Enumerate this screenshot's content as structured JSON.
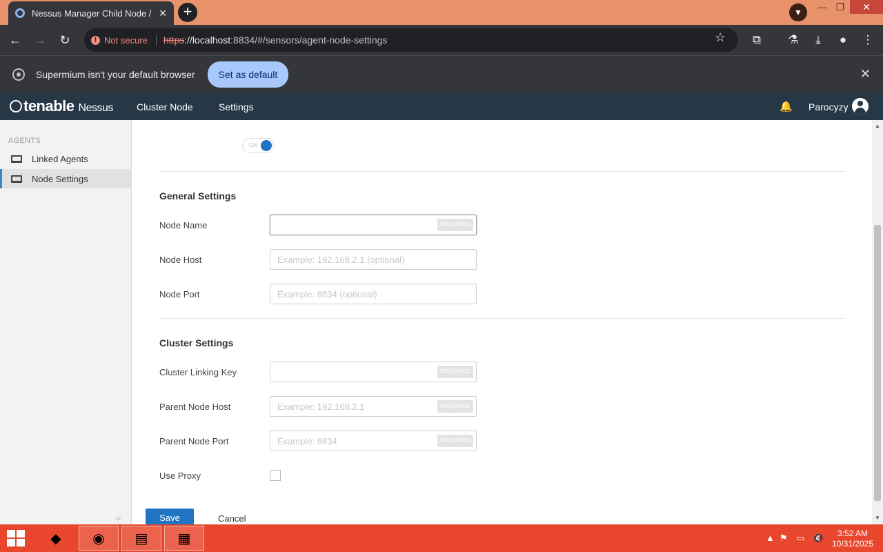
{
  "browser": {
    "tab_title": "Nessus Manager Child Node / P",
    "tab_close": "✕",
    "new_tab": "+",
    "security_label": "Not secure",
    "url_scheme": "https",
    "url_host": "://localhost",
    "url_rest": ":8834/#/sensors/agent-node-settings",
    "infobar_message": "Supermium isn't your default browser",
    "set_default_label": "Set as default"
  },
  "app": {
    "brand": "tenable",
    "product": "Nessus",
    "nav": [
      "Cluster Node",
      "Settings"
    ],
    "username": "Parocyzy"
  },
  "sidebar": {
    "heading": "AGENTS",
    "items": [
      {
        "label": "Linked Agents",
        "active": false
      },
      {
        "label": "Node Settings",
        "active": true
      }
    ],
    "collapse": "«"
  },
  "form": {
    "toggle_label": "ON",
    "general_heading": "General Settings",
    "cluster_heading": "Cluster Settings",
    "required_badge": "REQUIRED",
    "fields": {
      "node_name": {
        "label": "Node Name",
        "value": "",
        "placeholder": ""
      },
      "node_host": {
        "label": "Node Host",
        "value": "",
        "placeholder": "Example: 192.168.2.1 (optional)"
      },
      "node_port": {
        "label": "Node Port",
        "value": "",
        "placeholder": "Example: 8834 (optional)"
      },
      "linking_key": {
        "label": "Cluster Linking Key",
        "value": "",
        "placeholder": ""
      },
      "parent_host": {
        "label": "Parent Node Host",
        "value": "",
        "placeholder": "Example: 192.168.2.1"
      },
      "parent_port": {
        "label": "Parent Node Port",
        "value": "",
        "placeholder": "Example: 8834"
      },
      "use_proxy": {
        "label": "Use Proxy",
        "checked": false
      }
    },
    "save_label": "Save",
    "cancel_label": "Cancel"
  },
  "taskbar": {
    "time": "3:52 AM",
    "date": "10/31/2025"
  },
  "colors": {
    "accent": "#1f74c4",
    "header_bg": "#263746",
    "taskbar_bg": "#e8472e",
    "titlebar_bg": "#e8926b"
  }
}
